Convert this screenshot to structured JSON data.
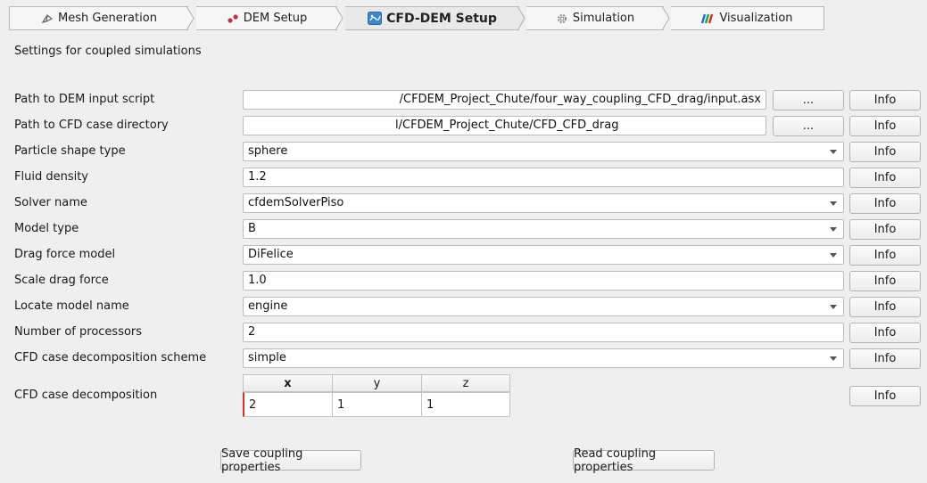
{
  "stages": [
    {
      "label": "Mesh Generation",
      "icon": "mesh-icon"
    },
    {
      "label": "DEM Setup",
      "icon": "particles-icon"
    },
    {
      "label": "CFD-DEM Setup",
      "icon": "cfd-dem-icon"
    },
    {
      "label": "Simulation",
      "icon": "gear-icon"
    },
    {
      "label": "Visualization",
      "icon": "visualization-icon"
    }
  ],
  "active_stage": "CFD-DEM Setup",
  "description": "Settings for coupled simulations",
  "browse_label": "...",
  "info_label": "Info",
  "fields": {
    "dem_input": {
      "label": "Path to DEM input script",
      "value": "/CFDEM_Project_Chute/four_way_coupling_CFD_drag/input.asx"
    },
    "cfd_dir": {
      "label": "Path to CFD case directory",
      "value": "l/CFDEM_Project_Chute/CFD_CFD_drag"
    },
    "particle_shape": {
      "label": "Particle shape type",
      "value": "sphere"
    },
    "fluid_density": {
      "label": "Fluid density",
      "value": "1.2"
    },
    "solver_name": {
      "label": "Solver name",
      "value": "cfdemSolverPiso"
    },
    "model_type": {
      "label": "Model type",
      "value": "B"
    },
    "drag_model": {
      "label": "Drag force model",
      "value": "DiFelice"
    },
    "scale_drag": {
      "label": "Scale drag force",
      "value": "1.0"
    },
    "locate_model": {
      "label": "Locate model name",
      "value": "engine"
    },
    "num_procs": {
      "label": "Number of processors",
      "value": "2"
    },
    "decomp_scheme": {
      "label": "CFD case decomposition scheme",
      "value": "simple"
    }
  },
  "decomposition": {
    "label": "CFD case decomposition",
    "columns": [
      "x",
      "y",
      "z"
    ],
    "values": [
      "2",
      "1",
      "1"
    ]
  },
  "actions": {
    "save": "Save coupling properties",
    "read": "Read coupling properties"
  }
}
